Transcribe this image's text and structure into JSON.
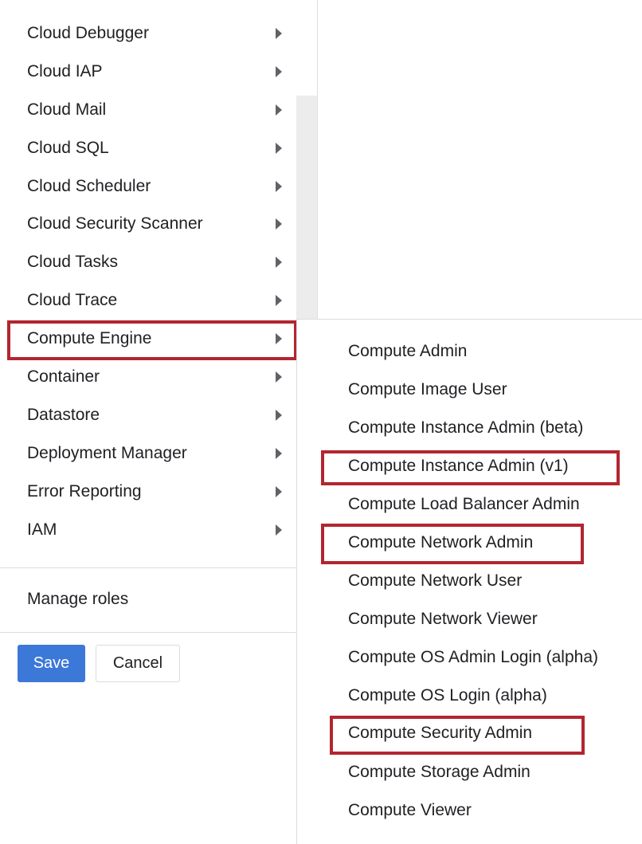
{
  "left_menu": {
    "items": [
      {
        "label": "Cloud Debugger"
      },
      {
        "label": "Cloud IAP"
      },
      {
        "label": "Cloud Mail"
      },
      {
        "label": "Cloud SQL"
      },
      {
        "label": "Cloud Scheduler"
      },
      {
        "label": "Cloud Security Scanner"
      },
      {
        "label": "Cloud Tasks"
      },
      {
        "label": "Cloud Trace"
      },
      {
        "label": "Compute Engine",
        "selected": true
      },
      {
        "label": "Container"
      },
      {
        "label": "Datastore"
      },
      {
        "label": "Deployment Manager"
      },
      {
        "label": "Error Reporting"
      },
      {
        "label": "IAM"
      }
    ],
    "manage_roles_label": "Manage roles"
  },
  "actions": {
    "save_label": "Save",
    "cancel_label": "Cancel"
  },
  "sub_menu": {
    "items": [
      {
        "label": "Compute Admin"
      },
      {
        "label": "Compute Image User"
      },
      {
        "label": "Compute Instance Admin (beta)"
      },
      {
        "label": "Compute Instance Admin (v1)",
        "highlighted": true
      },
      {
        "label": "Compute Load Balancer Admin"
      },
      {
        "label": "Compute Network Admin",
        "highlighted": true
      },
      {
        "label": "Compute Network User"
      },
      {
        "label": "Compute Network Viewer"
      },
      {
        "label": "Compute OS Admin Login (alpha)"
      },
      {
        "label": "Compute OS Login (alpha)"
      },
      {
        "label": "Compute Security Admin",
        "highlighted": true
      },
      {
        "label": "Compute Storage Admin"
      },
      {
        "label": "Compute Viewer"
      }
    ]
  },
  "colors": {
    "highlight": "#b3262f",
    "primary_button": "#3c78d8",
    "arrow": "#5f6368"
  },
  "icons": {
    "submenu_arrow": "triangle-right-icon"
  }
}
